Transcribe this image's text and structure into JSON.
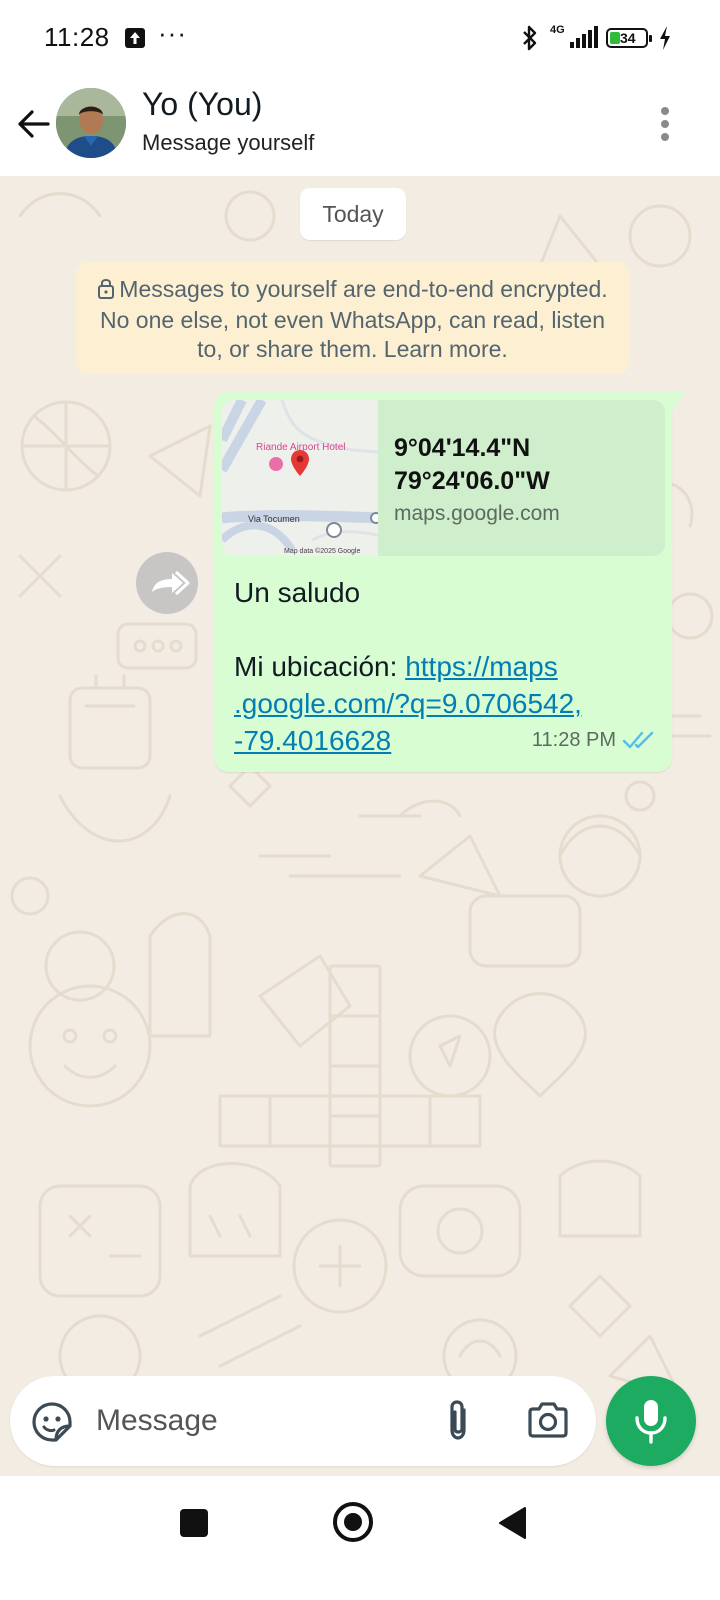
{
  "status_bar": {
    "time": "11:28",
    "network": "4G",
    "battery_level": "34"
  },
  "header": {
    "contact_name": "Yo (You)",
    "contact_status": "Message yourself"
  },
  "chat": {
    "date_label": "Today",
    "encryption_notice": "Messages to yourself are end-to-end encrypted. No one else, not even WhatsApp, can read, listen to, or share them. Learn more.",
    "message": {
      "preview": {
        "map_place_label": "Riande Airport Hotel",
        "map_road_label": "Via Tocumen",
        "map_credit": "Map data ©2025 Google",
        "coordinates": "9°04'14.4\"N\n79°24'06.0\"W",
        "domain": "maps.google.com"
      },
      "greeting": "Un saludo",
      "location_prefix": "Mi ubicación: ",
      "link_line1": "https://maps",
      "link_line2": ".google.com/?q=9.0706542,",
      "link_line3": "-79.4016628",
      "time": "11:28 PM",
      "status": "read"
    }
  },
  "input": {
    "placeholder": "Message"
  },
  "colors": {
    "accent_green": "#1daa61",
    "bubble_out": "#d9fdd3",
    "link": "#027eb5",
    "read_tick": "#53bdeb",
    "notice_bg": "#fdf0d2",
    "chat_bg": "#f2ece3"
  },
  "icons": {
    "back": "arrow-left-icon",
    "menu": "more-vert-icon",
    "lock": "lock-icon",
    "forward": "forward-icon",
    "emoji": "sticker-icon",
    "attach": "paperclip-icon",
    "camera": "camera-icon",
    "mic": "mic-icon",
    "read": "double-check-icon"
  }
}
